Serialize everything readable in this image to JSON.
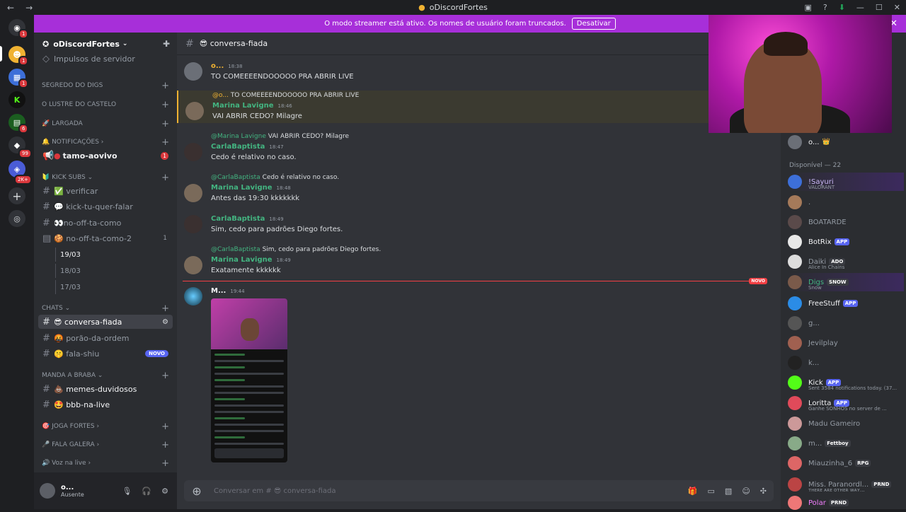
{
  "window": {
    "title": "oDiscordFortes",
    "back": "←",
    "forward": "→"
  },
  "banner": {
    "text": "O modo streamer está ativo. Os nomes de usuário foram truncados.",
    "button": "Desativar"
  },
  "guilds": {
    "badges": [
      "1",
      "1",
      "1",
      "6",
      "99",
      "2K+"
    ]
  },
  "server": {
    "name": "oDiscordFortes",
    "boost": "Impulsos de servidor",
    "categories": [
      "SEGREDO DO DIGS",
      "O LUSTRE DO CASTELO",
      "LARGADA",
      "NOTIFICAÇÕES",
      "KICK SUBS",
      "CHATS",
      "MANDA A BRABA",
      "JOGA FORTES",
      "FALA GALERA",
      "Voz na live"
    ],
    "channels": {
      "tamo": "tamo-aovivo",
      "tamo_badge": "1",
      "verificar": "verificar",
      "kick": "kick-tu-quer-falar",
      "nooff": "no-off-ta-como",
      "nooff2": "no-off-ta-como-2",
      "nooff2_count": "1",
      "conversa": "conversa-fiada",
      "porao": "porão-da-ordem",
      "fala": "fala-shiu",
      "fala_badge": "NOVO",
      "memes": "memes-duvidosos",
      "bbb": "bbb-na-live"
    },
    "threads": [
      "19/03",
      "18/03",
      "17/03"
    ]
  },
  "user": {
    "name": "o...",
    "status": "Ausente"
  },
  "channel": {
    "name": "conversa-fiada",
    "placeholder": "Conversar em # 😎 conversa-fiada"
  },
  "messages": [
    {
      "author": "o...",
      "time": "18:38",
      "text": "TO COMEEEENDOOOOO PRA ABRIR LIVE"
    },
    {
      "reply_name": "@o...",
      "reply_text": "TO COMEEEENDOOOOO PRA ABRIR LIVE",
      "author": "Marina Lavigne",
      "time": "18:46",
      "text": "VAI ABRIR CEDO? Milagre"
    },
    {
      "reply_name": "@Marina Lavigne",
      "reply_text": "VAI ABRIR CEDO? Milagre",
      "author": "CarlaBaptista",
      "time": "18:47",
      "text": "Cedo é relativo no caso."
    },
    {
      "reply_name": "@CarlaBaptista",
      "reply_text": "Cedo é relativo no caso.",
      "author": "Marina Lavigne",
      "time": "18:48",
      "text": "Antes das 19:30 kkkkkkk"
    },
    {
      "author": "CarlaBaptista",
      "time": "18:49",
      "text": "Sim, cedo para padrões Diego fortes."
    },
    {
      "reply_name": "@CarlaBaptista",
      "reply_text": "Sim, cedo para padrões Diego fortes.",
      "author": "Marina Lavigne",
      "time": "18:49",
      "text": "Exatamente kkkkkk"
    },
    {
      "author": "M...",
      "time": "19:44"
    }
  ],
  "new_marker": "NOVO",
  "members": {
    "categories": [
      "Disponível — 22"
    ],
    "list": [
      {
        "name": "o...",
        "extra": "👑"
      },
      {
        "name": "!Sayuri",
        "sub": "VALORANT"
      },
      {
        "name": "."
      },
      {
        "name": "BOATARDE"
      },
      {
        "name": "BotRix",
        "tag": "APP"
      },
      {
        "name": "Daiki",
        "tag": "ADO",
        "sub": "Alice In Chains"
      },
      {
        "name": "Digs",
        "tag": "SNOW",
        "sub": "Snow"
      },
      {
        "name": "FreeStuff",
        "tag": "APP"
      },
      {
        "name": "g..."
      },
      {
        "name": "Jevilplay"
      },
      {
        "name": "k..."
      },
      {
        "name": "Kick",
        "tag": "APP",
        "sub": "Sent 3584 notifications today. (37..."
      },
      {
        "name": "Loritta",
        "tag": "APP",
        "sub": "Ganhe SONHOS no server de ..."
      },
      {
        "name": "Madu Gameiro"
      },
      {
        "name": "m...",
        "tag": "Fettboy"
      },
      {
        "name": "Miauzinha_6",
        "tag": "RPG"
      },
      {
        "name": "Miss. Paranordl...",
        "tag": "PRND",
        "sub": "ᴛʜᴇʀᴇ ᴀʀᴇ ᴏᴛʜᴇʀ ᴡᴀʏ..."
      },
      {
        "name": "Polar",
        "tag": "PRND"
      }
    ]
  },
  "colors": {
    "accent": "#5865f2",
    "banner": "#a72fd9",
    "online": "#23a55a",
    "mention": "#f0b232"
  }
}
